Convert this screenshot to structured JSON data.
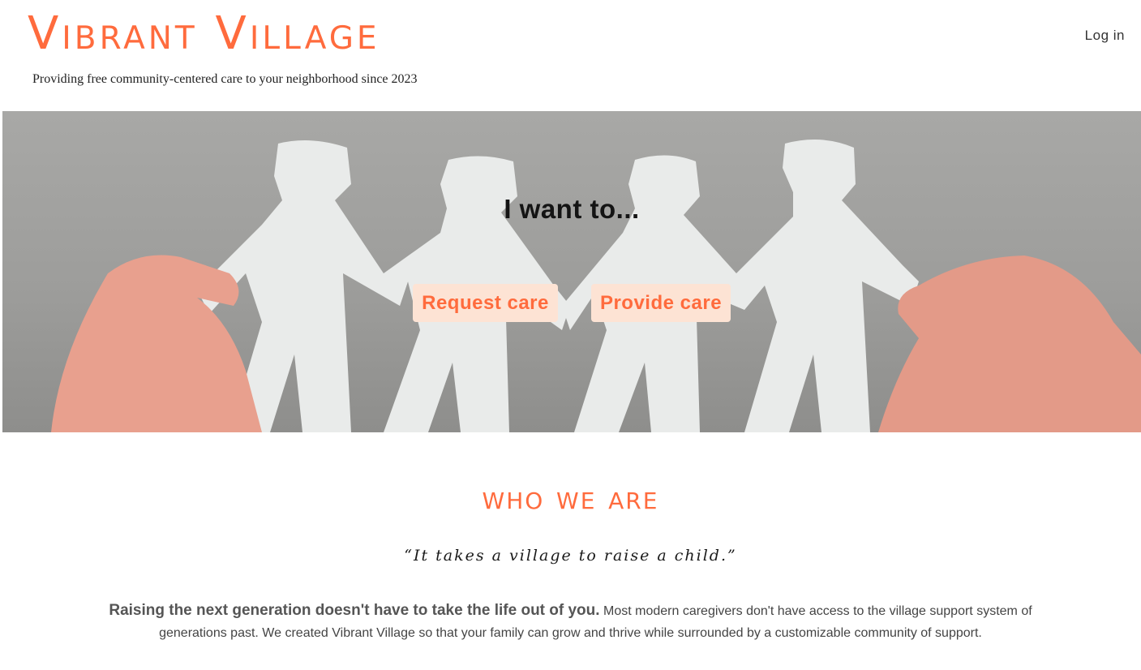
{
  "header": {
    "brand_title": "Vibrant Village",
    "tagline": "Providing free community-centered care to your neighborhood since 2023",
    "login_label": "Log in"
  },
  "hero": {
    "heading": "I want to...",
    "request_label": "Request care",
    "provide_label": "Provide care"
  },
  "about": {
    "title": "who we are",
    "quote": "“It takes a village to raise a child.”",
    "lead": "Raising the next generation doesn't have to take the life out of you.",
    "body": "Most modern caregivers don't have access to the village support system of generations past. We created Vibrant Village so that your family can grow and thrive while surrounded by a customizable community of support."
  },
  "colors": {
    "accent": "#ff6b3d",
    "button_bg": "#fde3d4",
    "text_dark": "#141414"
  }
}
